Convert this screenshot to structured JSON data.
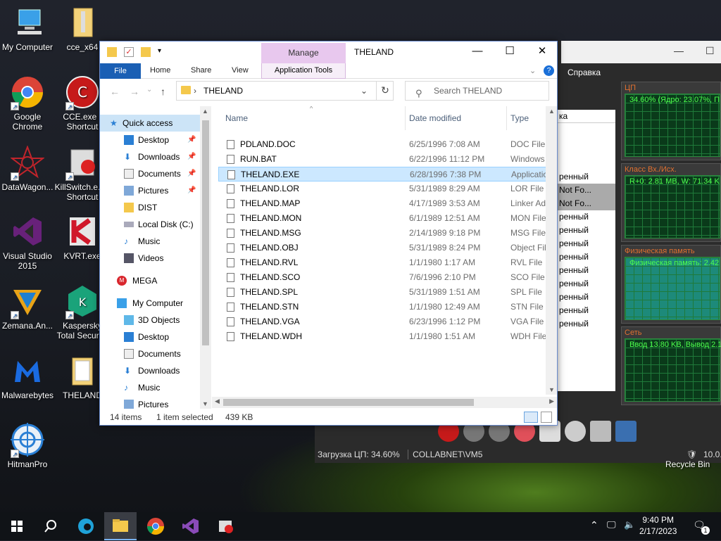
{
  "desktop": {
    "icons": [
      {
        "label": "My Computer"
      },
      {
        "label": "cce_x64"
      },
      {
        "label": "Google Chrome"
      },
      {
        "label": "CCE.exe - Shortcut"
      },
      {
        "label": "DataWagon..."
      },
      {
        "label": "KillSwitch.e... - Shortcut"
      },
      {
        "label": "Visual Studio 2015"
      },
      {
        "label": "KVRT.exe"
      },
      {
        "label": "Zemana.An..."
      },
      {
        "label": "Kaspersky Total Securi..."
      },
      {
        "label": "Malwarebytes"
      },
      {
        "label": "THELAND"
      },
      {
        "label": "HitmanPro"
      }
    ],
    "recycle_bin": "Recycle Bin"
  },
  "sysmon": {
    "menu_label": "Справка",
    "panels": [
      {
        "title": "ЦП",
        "label": "34.60% (Ядро: 23.07%, П"
      },
      {
        "title": "Класс Вх./Исх.",
        "label": "R+0: 2.81 MB, W: 71.34 K"
      },
      {
        "title": "Физическая память",
        "label": "Физическая память: 2.42"
      },
      {
        "title": "Сеть",
        "label": "Ввод 13.80 KB, Вывод 2.1"
      }
    ],
    "list_header": "ка",
    "list_items": [
      "ренный",
      "Not Fo...",
      "Not Fo...",
      "ренный",
      "ренный",
      "ренный",
      "ренный",
      "ренный",
      "ренный",
      "ренный",
      "ренный",
      "ренный"
    ],
    "status_cpu": "Загрузка ЦП: 34.60%",
    "status_user": "COLLABNET\\VM5",
    "status_version": "10.0."
  },
  "explorer": {
    "manage_tab": "Manage",
    "window_title": "THELAND",
    "ribbon": {
      "file": "File",
      "home": "Home",
      "share": "Share",
      "view": "View",
      "app_tools": "Application Tools"
    },
    "address": "THELAND",
    "search_placeholder": "Search THELAND",
    "nav": [
      {
        "label": "Quick access",
        "icon": "star-icon"
      },
      {
        "label": "Desktop",
        "icon": "desktop-icon",
        "pinned": true
      },
      {
        "label": "Downloads",
        "icon": "download-icon",
        "pinned": true
      },
      {
        "label": "Documents",
        "icon": "documents-icon",
        "pinned": true
      },
      {
        "label": "Pictures",
        "icon": "pictures-icon",
        "pinned": true
      },
      {
        "label": "DIST",
        "icon": "folder-icon"
      },
      {
        "label": "Local Disk (C:)",
        "icon": "drive-icon"
      },
      {
        "label": "Music",
        "icon": "music-icon"
      },
      {
        "label": "Videos",
        "icon": "videos-icon"
      },
      {
        "label": "MEGA",
        "icon": "mega-icon"
      },
      {
        "label": "My Computer",
        "icon": "computer-icon"
      },
      {
        "label": "3D Objects",
        "icon": "3d-objects-icon"
      },
      {
        "label": "Desktop",
        "icon": "desktop-icon"
      },
      {
        "label": "Documents",
        "icon": "documents-icon"
      },
      {
        "label": "Downloads",
        "icon": "download-icon"
      },
      {
        "label": "Music",
        "icon": "music-icon"
      },
      {
        "label": "Pictures",
        "icon": "pictures-icon"
      }
    ],
    "columns": {
      "name": "Name",
      "date": "Date modified",
      "type": "Type",
      "extra": "ка"
    },
    "files": [
      {
        "name": "PDLAND.DOC",
        "date": "6/25/1996 7:08 AM",
        "type": "DOC File"
      },
      {
        "name": "RUN.BAT",
        "date": "6/22/1996 11:12 PM",
        "type": "Windows Bat"
      },
      {
        "name": "THELAND.EXE",
        "date": "6/28/1996 7:38 PM",
        "type": "Application",
        "selected": true
      },
      {
        "name": "THELAND.LOR",
        "date": "5/31/1989 8:29 AM",
        "type": "LOR File"
      },
      {
        "name": "THELAND.MAP",
        "date": "4/17/1989 3:53 AM",
        "type": "Linker Addre"
      },
      {
        "name": "THELAND.MON",
        "date": "6/1/1989 12:51 AM",
        "type": "MON File"
      },
      {
        "name": "THELAND.MSG",
        "date": "2/14/1989 9:18 PM",
        "type": "MSG File"
      },
      {
        "name": "THELAND.OBJ",
        "date": "5/31/1989 8:24 PM",
        "type": "Object File"
      },
      {
        "name": "THELAND.RVL",
        "date": "1/1/1980 1:17 AM",
        "type": "RVL File"
      },
      {
        "name": "THELAND.SCO",
        "date": "7/6/1996 2:10 PM",
        "type": "SCO File"
      },
      {
        "name": "THELAND.SPL",
        "date": "5/31/1989 1:51 AM",
        "type": "SPL File"
      },
      {
        "name": "THELAND.STN",
        "date": "1/1/1980 12:49 AM",
        "type": "STN File"
      },
      {
        "name": "THELAND.VGA",
        "date": "6/23/1996 1:12 PM",
        "type": "VGA File"
      },
      {
        "name": "THELAND.WDH",
        "date": "1/1/1980 1:51 AM",
        "type": "WDH File"
      }
    ],
    "status": {
      "count": "14 items",
      "selected": "1 item selected",
      "size": "439 KB"
    }
  },
  "taskbar": {
    "time": "9:40 PM",
    "date": "2/17/2023",
    "notification_count": "1"
  }
}
